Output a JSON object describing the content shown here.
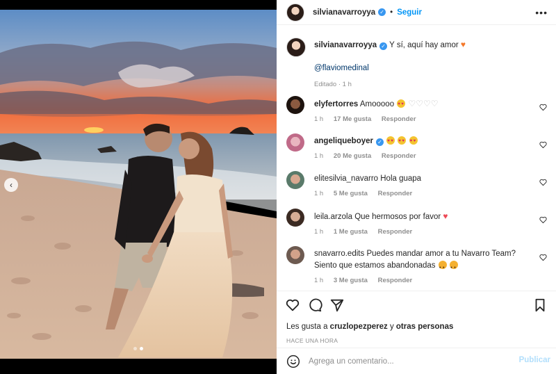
{
  "post": {
    "author": "silvianavarroyya",
    "separator": "•",
    "follow_label": "Seguir",
    "more_label": "•••",
    "caption_text": "Y sí, aquí hay amor",
    "caption_mention": "@flaviomedinal",
    "caption_meta": "Editado · 1 h",
    "slide_count": 2,
    "active_slide": 2
  },
  "comments": [
    {
      "user": "elyfertorres",
      "verified": false,
      "text": "Amooooo",
      "emoji": "hearts-eyes+4-white-hearts",
      "time": "1 h",
      "likes": "17 Me gusta",
      "reply": "Responder"
    },
    {
      "user": "angeliqueboyer",
      "verified": true,
      "text": "",
      "emoji": "3-hearts-eyes",
      "time": "1 h",
      "likes": "20 Me gusta",
      "reply": "Responder"
    },
    {
      "user": "elitesilvia_navarro",
      "verified": false,
      "text": "Hola guapa",
      "emoji": "",
      "time": "1 h",
      "likes": "5 Me gusta",
      "reply": "Responder"
    },
    {
      "user": "leila.arzola",
      "verified": false,
      "text": "Que hermosos por favor",
      "emoji": "red-heart",
      "time": "1 h",
      "likes": "1 Me gusta",
      "reply": "Responder"
    },
    {
      "user": "snavarro.edits",
      "verified": false,
      "text": "Puedes mandar amor a tu Navarro Team? Siento que estamos abandonadas",
      "emoji": "2-crying-faces",
      "time": "1 h",
      "likes": "3 Me gusta",
      "reply": "Responder"
    }
  ],
  "likes_prefix": "Les gusta a",
  "likes_user": "cruzlopezperez",
  "likes_and": "y",
  "likes_others": "otras personas",
  "time_ago": "HACE UNA HORA",
  "composer": {
    "placeholder": "Agrega un comentario...",
    "publish_label": "Publicar"
  },
  "colors": {
    "link_blue": "#0095f6",
    "mention_blue": "#00376b",
    "muted": "#8e8e8e",
    "publish_disabled": "#b2dffc",
    "verified": "#3897f0"
  }
}
